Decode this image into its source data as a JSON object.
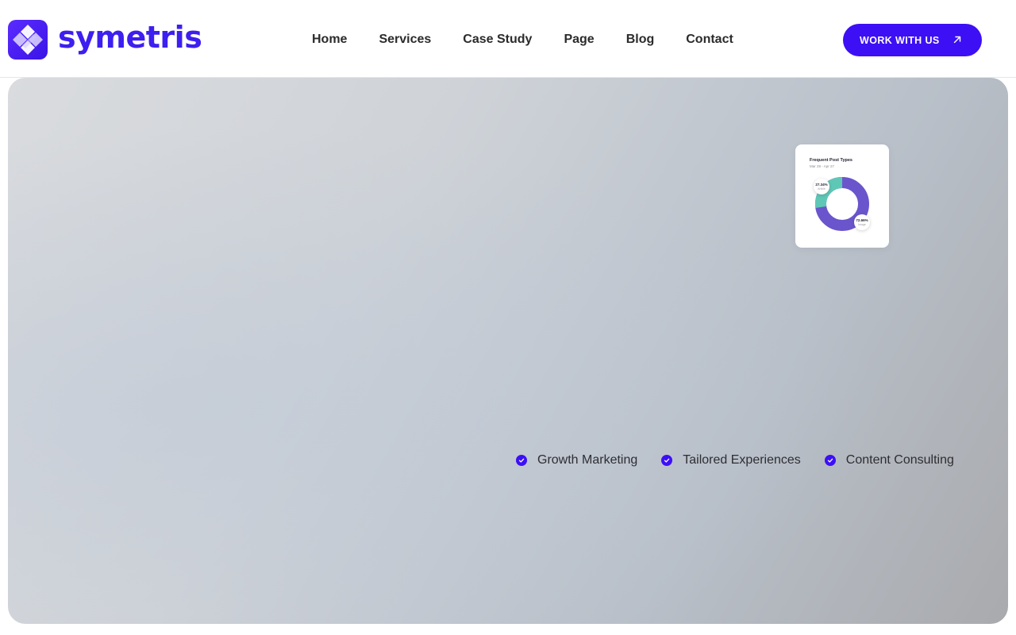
{
  "brand": {
    "name": "symetris",
    "accent": "#3d0ff5"
  },
  "nav": {
    "items": [
      {
        "label": "Home"
      },
      {
        "label": "Services"
      },
      {
        "label": "Case Study"
      },
      {
        "label": "Page"
      },
      {
        "label": "Blog"
      },
      {
        "label": "Contact"
      }
    ]
  },
  "cta": {
    "label": "WORK WITH US",
    "icon": "arrow-up-right-icon"
  },
  "hero": {
    "chart_card": {
      "title": "Frequent Post Types",
      "subtitle": "Mar 28 - Apr 27",
      "slices": [
        {
          "label": "Article",
          "value": 27.34,
          "text": "27.34%",
          "color": "#5fc7b6"
        },
        {
          "label": "Image",
          "value": 72.66,
          "text": "72.66%",
          "color": "#6a55cc"
        }
      ]
    },
    "features": [
      {
        "label": "Growth Marketing",
        "icon": "check-circle-icon"
      },
      {
        "label": "Tailored Experiences",
        "icon": "check-circle-icon"
      },
      {
        "label": "Content Consulting",
        "icon": "check-circle-icon"
      }
    ]
  }
}
